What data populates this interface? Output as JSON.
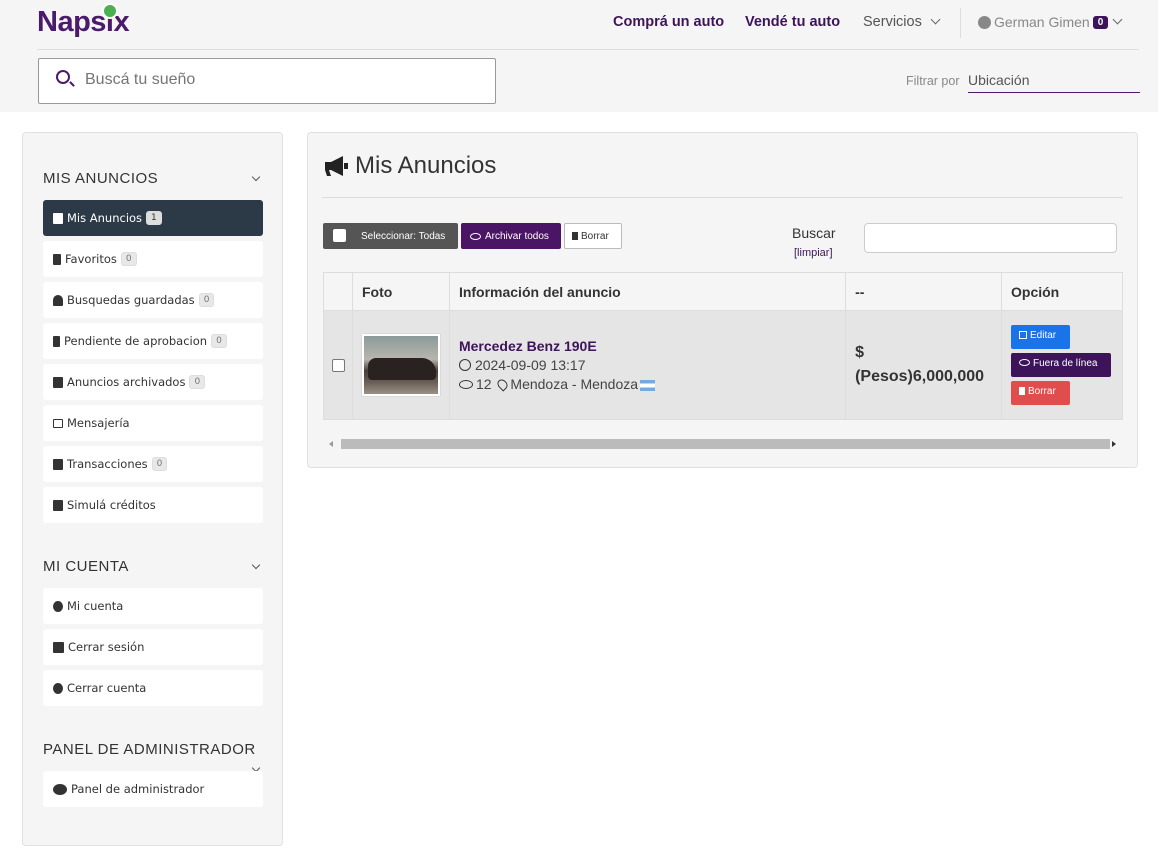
{
  "header": {
    "logo": "Napsix",
    "nav": [
      "Comprá un auto",
      "Vendé tu auto"
    ],
    "servicios": "Servicios",
    "user_name": "German Gimen",
    "user_badge": "0",
    "search_placeholder": "Buscá tu sueño",
    "filter_label": "Filtrar por",
    "filter_value": "Ubicación"
  },
  "sidebar": {
    "section1_title": "MIS ANUNCIOS",
    "items1": [
      {
        "label": "Mis Anuncios",
        "count": "1"
      },
      {
        "label": "Favoritos",
        "count": "0"
      },
      {
        "label": "Busquedas guardadas",
        "count": "0"
      },
      {
        "label": "Pendiente de aprobacion",
        "count": "0"
      },
      {
        "label": "Anuncios archivados",
        "count": "0"
      },
      {
        "label": "Mensajería",
        "count": ""
      },
      {
        "label": "Transacciones",
        "count": "0"
      },
      {
        "label": "Simulá créditos",
        "count": ""
      }
    ],
    "section2_title": "MI CUENTA",
    "items2": [
      {
        "label": "Mi cuenta"
      },
      {
        "label": "Cerrar sesión"
      },
      {
        "label": "Cerrar cuenta"
      }
    ],
    "section3_title": "PANEL DE ADMINISTRADOR",
    "items3": [
      {
        "label": "Panel de administrador"
      }
    ]
  },
  "main": {
    "title": "Mis Anuncios",
    "select_all": "Seleccionar: Todas",
    "archive_all": "Archivar todos",
    "delete": "Borrar",
    "buscar": "Buscar",
    "limpiar": "[limpiar]",
    "columns": [
      "",
      "Foto",
      "Información del anuncio",
      "--",
      "Opción"
    ],
    "row": {
      "title": "Mercedez Benz 190E",
      "datetime": "2024-09-09 13:17",
      "views": "12",
      "location": "Mendoza - Mendoza",
      "price_symbol": "$",
      "price": "(Pesos)6,000,000",
      "edit": "Editar",
      "offline": "Fuera de línea",
      "remove": "Borrar"
    }
  },
  "colors": {
    "brand": "#3d1459",
    "edit": "#1a73e8",
    "delete": "#e04d4d"
  }
}
